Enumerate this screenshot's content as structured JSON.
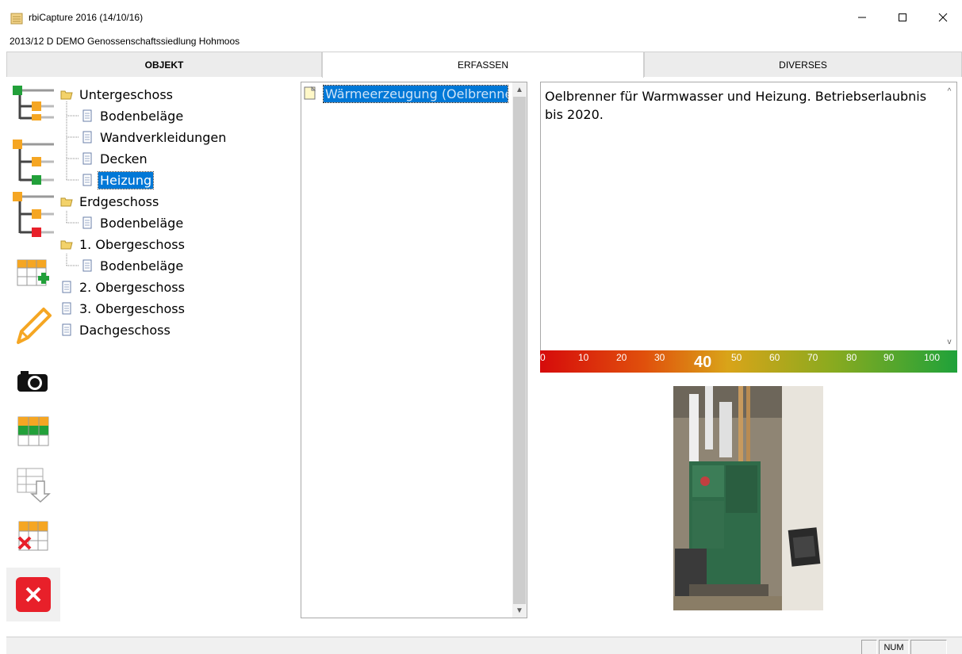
{
  "window": {
    "title": "rbiCapture 2016 (14/10/16)",
    "subtitle": "2013/12 D DEMO Genossenschaftssiedlung Hohmoos"
  },
  "tabs": [
    {
      "label": "OBJEKT"
    },
    {
      "label": "ERFASSEN"
    },
    {
      "label": "DIVERSES"
    }
  ],
  "tree": {
    "items": [
      {
        "label": "Untergeschoss",
        "icon": "folder-icon"
      },
      {
        "label": "Bodenbeläge",
        "icon": "document-icon"
      },
      {
        "label": "Wandverkleidungen",
        "icon": "document-icon"
      },
      {
        "label": "Decken",
        "icon": "document-icon"
      },
      {
        "label": "Heizung",
        "icon": "document-icon",
        "selected": true
      },
      {
        "label": "Erdgeschoss",
        "icon": "folder-icon"
      },
      {
        "label": "Bodenbeläge",
        "icon": "document-icon"
      },
      {
        "label": "1. Obergeschoss",
        "icon": "folder-icon"
      },
      {
        "label": "Bodenbeläge",
        "icon": "document-icon"
      },
      {
        "label": "2. Obergeschoss",
        "icon": "document-icon"
      },
      {
        "label": "3. Obergeschoss",
        "icon": "document-icon"
      },
      {
        "label": "Dachgeschoss",
        "icon": "document-icon"
      }
    ]
  },
  "list": {
    "items": [
      {
        "label": "Wärmeerzeugung (Oelbrenne",
        "selected": true
      }
    ]
  },
  "description": {
    "text": "Oelbrenner für Warmwasser und Heizung. Betriebserlaubnis bis 2020."
  },
  "gauge": {
    "ticks": [
      "0",
      "10",
      "20",
      "30",
      "50",
      "60",
      "70",
      "80",
      "90",
      "100"
    ],
    "value": "40"
  },
  "statusbar": {
    "num": "NUM"
  },
  "colors": {
    "selection": "#0078d7",
    "accent_orange": "#f5a623",
    "accent_green": "#22a03a",
    "accent_red": "#e8202a"
  }
}
